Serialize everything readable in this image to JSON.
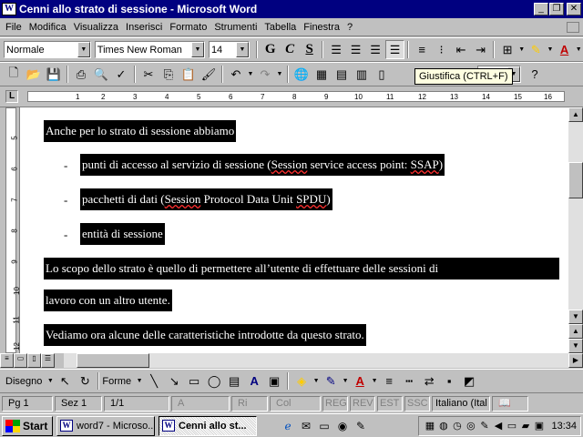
{
  "window": {
    "title": "Cenni allo strato di sessione - Microsoft Word"
  },
  "menu": [
    "File",
    "Modifica",
    "Visualizza",
    "Inserisci",
    "Formato",
    "Strumenti",
    "Tabella",
    "Finestra",
    "?"
  ],
  "format_toolbar": {
    "style": "Normale",
    "font": "Times New Roman",
    "size": "14",
    "bold": "G",
    "italic": "C",
    "underline": "S"
  },
  "standard_toolbar": {
    "zoom": "%"
  },
  "tooltip": "Giustifica (CTRL+F)",
  "ruler": {
    "ticks": [
      "1",
      "2",
      "3",
      "4",
      "5",
      "6",
      "7",
      "8",
      "9",
      "10",
      "11",
      "12",
      "13",
      "14",
      "15",
      "16"
    ],
    "vticks": [
      "5",
      "6",
      "7",
      "8",
      "9",
      "10",
      "11",
      "12"
    ]
  },
  "document": {
    "intro": "Anche per lo strato di sessione abbiamo",
    "bullet_marker": "-",
    "bullets": [
      {
        "a": "punti di accesso al servizio di sessione (",
        "b": "Session",
        "c": " service access point: ",
        "d": "SSAP",
        "e": ")"
      },
      {
        "a": "pacchetti di dati (",
        "b": "Session",
        "c": " Protocol Data Unit ",
        "d": "SPDU",
        "e": ")"
      },
      {
        "a": "entità di sessione",
        "b": "",
        "c": "",
        "d": "",
        "e": ""
      }
    ],
    "para1_line1": "Lo scopo dello strato è quello di permettere all’utente di effettuare delle sessioni di",
    "para1_line2": "lavoro con un altro utente.",
    "para2": "Vediamo ora alcune delle caratteristiche introdotte da questo strato."
  },
  "drawing_toolbar": {
    "draw": "Disegno",
    "shapes": "Forme"
  },
  "status": {
    "page": "Pg 1",
    "section": "Sez 1",
    "pages": "1/1",
    "at": "A",
    "line": "Ri",
    "col": "Col",
    "reg": "REG",
    "rev": "REV",
    "est": "EST",
    "ssc": "SSC",
    "lang": "Italiano (Ital"
  },
  "taskbar": {
    "start": "Start",
    "tasks": [
      "word7 - Microso...",
      "Cenni allo st..."
    ],
    "clock": "13:34"
  }
}
